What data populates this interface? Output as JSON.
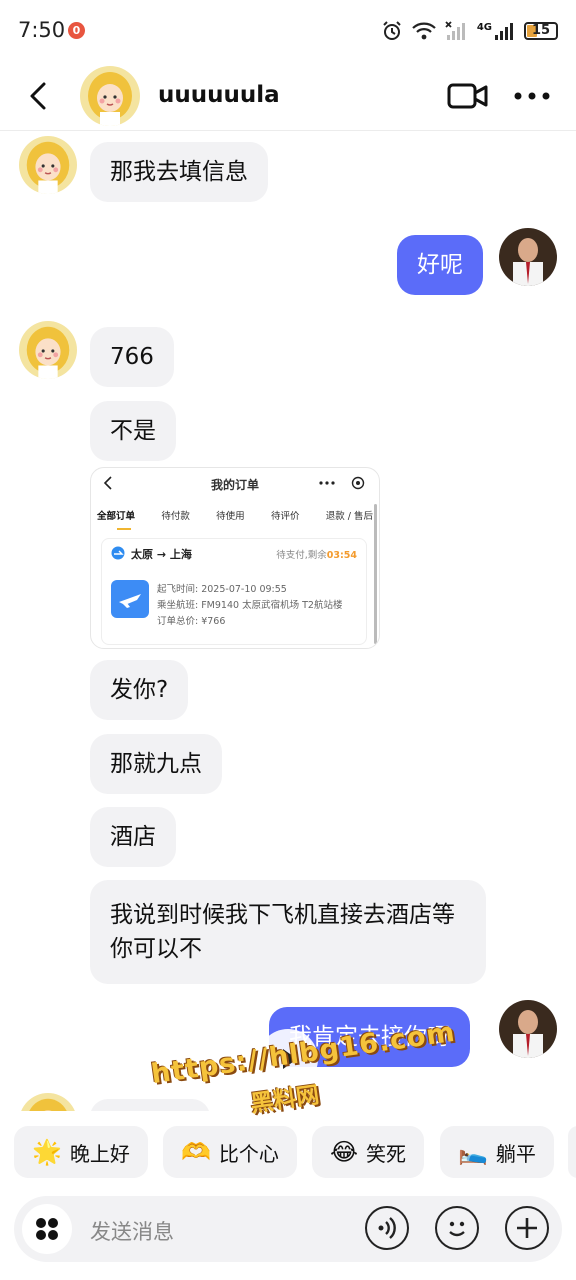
{
  "status_bar": {
    "time": "7:50",
    "notification_count": "0",
    "network_label": "4G",
    "battery": "15"
  },
  "header": {
    "name": "uuuuuula"
  },
  "messages": [
    {
      "from": "them",
      "text": "那我去填信息"
    },
    {
      "from": "me",
      "text": "好呢"
    },
    {
      "from": "them",
      "text": "766"
    },
    {
      "from": "them",
      "text": "不是"
    },
    {
      "from": "them",
      "text": "发你?"
    },
    {
      "from": "them",
      "text": "那就九点"
    },
    {
      "from": "them",
      "text": "酒店"
    },
    {
      "from": "them",
      "text": "我说到时候我下飞机直接去酒店等你可以不"
    },
    {
      "from": "me",
      "text": "我肯定去接你呀"
    }
  ],
  "order_card": {
    "title": "我的订单",
    "tabs": [
      "全部订单",
      "待付款",
      "待使用",
      "待评价",
      "退款 / 售后"
    ],
    "route": "太原 → 上海",
    "status_prefix": "待支付,剩余",
    "countdown": "03:54",
    "details": [
      "起飞时间: 2025-07-10 09:55",
      "乘坐航班: FM9140 太原武宿机场 T2航站楼",
      "订单总价: ¥766"
    ]
  },
  "watermark": {
    "line1": "https://hlbg16.com",
    "line2": "黑料网"
  },
  "quick_replies": [
    {
      "emoji": "🌟",
      "label": "晚上好"
    },
    {
      "emoji": "🫶",
      "label": "比个心"
    },
    {
      "emoji": "😂",
      "label": "笑死"
    },
    {
      "emoji": "🛌",
      "label": "躺平"
    }
  ],
  "input": {
    "placeholder": "发送消息"
  }
}
